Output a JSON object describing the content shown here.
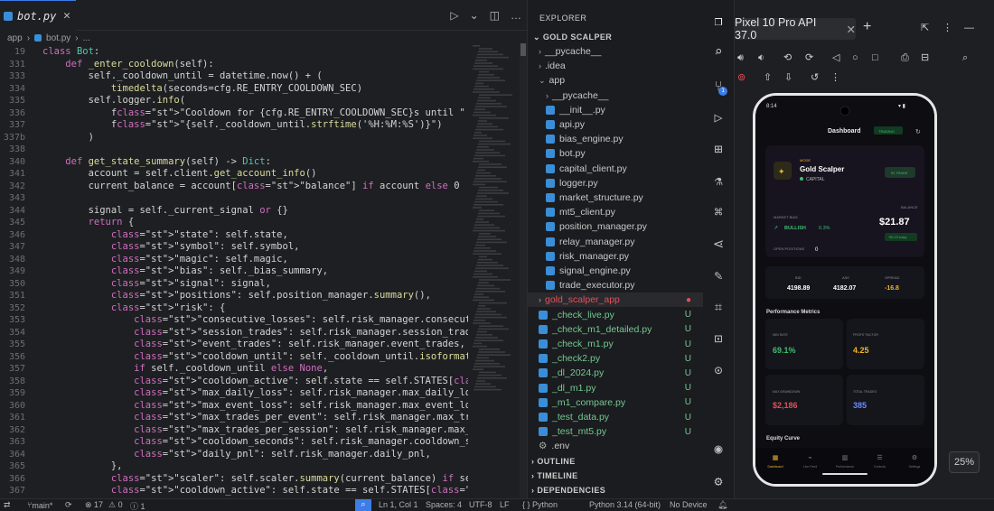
{
  "editor": {
    "tab_label": "bot.py",
    "tab_close": "✕",
    "breadcrumb": [
      "app",
      "bot.py",
      "..."
    ],
    "lines": [
      {
        "n": "19",
        "t": "class Bot:"
      },
      {
        "n": "331",
        "t": "    def _enter_cooldown(self):"
      },
      {
        "n": "333",
        "t": "        self._cooldown_until = datetime.now() + ("
      },
      {
        "n": "334",
        "t": "            timedelta(seconds=cfg.RE_ENTRY_COOLDOWN_SEC)"
      },
      {
        "n": "335",
        "t": "        self.logger.info("
      },
      {
        "n": "336",
        "t": "            f\"Cooldown for {cfg.RE_ENTRY_COOLDOWN_SEC}s until \""
      },
      {
        "n": "337",
        "t": "            f\"{self._cooldown_until.strftime('%H:%M:%S')}\")"
      },
      {
        "n": "337b",
        "t": "        )"
      },
      {
        "n": "338",
        "t": ""
      },
      {
        "n": "340",
        "t": "    def get_state_summary(self) -> Dict:"
      },
      {
        "n": "341",
        "t": "        account = self.client.get_account_info()"
      },
      {
        "n": "342",
        "t": "        current_balance = account[\"balance\"] if account else 0"
      },
      {
        "n": "343",
        "t": ""
      },
      {
        "n": "344",
        "t": "        signal = self._current_signal or {}"
      },
      {
        "n": "345",
        "t": "        return {"
      },
      {
        "n": "346",
        "t": "            \"state\": self.state,"
      },
      {
        "n": "347",
        "t": "            \"symbol\": self.symbol,"
      },
      {
        "n": "348",
        "t": "            \"magic\": self.magic,"
      },
      {
        "n": "349",
        "t": "            \"bias\": self._bias_summary,"
      },
      {
        "n": "350",
        "t": "            \"signal\": signal,"
      },
      {
        "n": "351",
        "t": "            \"positions\": self.position_manager.summary(),"
      },
      {
        "n": "352",
        "t": "            \"risk\": {"
      },
      {
        "n": "353",
        "t": "                \"consecutive_losses\": self.risk_manager.consecutive_losses,"
      },
      {
        "n": "354",
        "t": "                \"session_trades\": self.risk_manager.session_trades,"
      },
      {
        "n": "355",
        "t": "                \"event_trades\": self.risk_manager.event_trades,"
      },
      {
        "n": "356",
        "t": "                \"cooldown_until\": self._cooldown_until.isoformat()"
      },
      {
        "n": "357",
        "t": "                if self._cooldown_until else None,"
      },
      {
        "n": "358",
        "t": "                \"cooldown_active\": self.state == self.STATES[\"COOLDOWN\"],"
      },
      {
        "n": "359",
        "t": "                \"max_daily_loss\": self.risk_manager.max_daily_loss,"
      },
      {
        "n": "360",
        "t": "                \"max_event_loss\": self.risk_manager.max_event_loss,"
      },
      {
        "n": "361",
        "t": "                \"max_trades_per_event\": self.risk_manager.max_trades_per_event,"
      },
      {
        "n": "362",
        "t": "                \"max_trades_per_session\": self.risk_manager.max_trades_per_session,"
      },
      {
        "n": "363",
        "t": "                \"cooldown_seconds\": self.risk_manager.cooldown_seconds,"
      },
      {
        "n": "364",
        "t": "                \"daily_pnl\": self.risk_manager.daily_pnl,"
      },
      {
        "n": "365",
        "t": "            },"
      },
      {
        "n": "366",
        "t": "            \"scaler\": self.scaler.summary(current_balance) if self.scaler.starting_"
      },
      {
        "n": "367",
        "t": "            \"cooldown_active\": self.state == self.STATES[\"COOLDOWN\"]"
      }
    ]
  },
  "explorer": {
    "header": "EXPLORER",
    "project": "GOLD SCALPER",
    "items": [
      {
        "label": "__pycache__",
        "kind": "folder",
        "indent": 1,
        "chev": "›"
      },
      {
        "label": ".idea",
        "kind": "folder",
        "indent": 1,
        "chev": "›"
      },
      {
        "label": "app",
        "kind": "folder",
        "indent": 1,
        "chev": "⌄"
      },
      {
        "label": "__pycache__",
        "kind": "folder",
        "indent": 2,
        "chev": "›"
      },
      {
        "label": "__init__.py",
        "kind": "py",
        "indent": 2
      },
      {
        "label": "api.py",
        "kind": "py",
        "indent": 2
      },
      {
        "label": "bias_engine.py",
        "kind": "py",
        "indent": 2
      },
      {
        "label": "bot.py",
        "kind": "py",
        "indent": 2
      },
      {
        "label": "capital_client.py",
        "kind": "py",
        "indent": 2
      },
      {
        "label": "logger.py",
        "kind": "py",
        "indent": 2
      },
      {
        "label": "market_structure.py",
        "kind": "py",
        "indent": 2
      },
      {
        "label": "mt5_client.py",
        "kind": "py",
        "indent": 2
      },
      {
        "label": "position_manager.py",
        "kind": "py",
        "indent": 2
      },
      {
        "label": "relay_manager.py",
        "kind": "py",
        "indent": 2
      },
      {
        "label": "risk_manager.py",
        "kind": "py",
        "indent": 2
      },
      {
        "label": "signal_engine.py",
        "kind": "py",
        "indent": 2
      },
      {
        "label": "trade_executor.py",
        "kind": "py",
        "indent": 2
      },
      {
        "label": "gold_scalper_app",
        "kind": "folder-red",
        "indent": 1,
        "chev": "›",
        "status": "●"
      },
      {
        "label": "_check_live.py",
        "kind": "new",
        "indent": 1,
        "status": "U"
      },
      {
        "label": "_check_m1_detailed.py",
        "kind": "new",
        "indent": 1,
        "status": "U"
      },
      {
        "label": "_check_m1.py",
        "kind": "new",
        "indent": 1,
        "status": "U"
      },
      {
        "label": "_check2.py",
        "kind": "new",
        "indent": 1,
        "status": "U"
      },
      {
        "label": "_dl_2024.py",
        "kind": "new",
        "indent": 1,
        "status": "U"
      },
      {
        "label": "_dl_m1.py",
        "kind": "new",
        "indent": 1,
        "status": "U"
      },
      {
        "label": "_m1_compare.py",
        "kind": "new",
        "indent": 1,
        "status": "U"
      },
      {
        "label": "_test_data.py",
        "kind": "new",
        "indent": 1,
        "status": "U"
      },
      {
        "label": "_test_mt5.py",
        "kind": "new",
        "indent": 1,
        "status": "U"
      },
      {
        "label": ".env",
        "kind": "gear",
        "indent": 1
      }
    ],
    "sections": [
      "OUTLINE",
      "TIMELINE",
      "DEPENDENCIES"
    ]
  },
  "emulator": {
    "device_tab": "Pixel 10 Pro API 37.0",
    "zoom": "25%",
    "app": {
      "time": "8:14",
      "title": "Dashboard",
      "trading_badge": "TRADING",
      "mode": "MODE",
      "name": "Gold Scalper",
      "account": "CAPITAL",
      "in_trade": "IN TRADE",
      "balance_label": "BALANCE",
      "balance": "$21.87",
      "balance_change": "+$1.23 today",
      "bias_label": "MARKET BIAS",
      "bias": "BULLISH",
      "bias_pct": "0.3%",
      "open_positions_label": "OPEN POSITIONS",
      "open_positions": "0",
      "bid_label": "BID",
      "bid": "4198.89",
      "ask_label": "ASK",
      "ask": "4182.07",
      "spread_label": "SPREAD",
      "spread": "-16.8",
      "perf_title": "Performance Metrics",
      "win_rate_label": "WIN RATE",
      "win_rate": "69.1%",
      "pf_label": "PROFIT FACTOR",
      "pf": "4.25",
      "drawdown_label": "MAX DRAWDOWN",
      "drawdown": "$2,186",
      "trades_label": "TOTAL TRADES",
      "trades": "385",
      "equity_title": "Equity Curve",
      "nav": [
        "Dashboard",
        "Live Feed",
        "Performance",
        "Controls",
        "Settings"
      ]
    }
  },
  "status": {
    "branch": "main*",
    "sync": "⟳",
    "errors": "⊗ 17",
    "warnings": "⚠ 0",
    "info": "ⓘ 1",
    "position": "Ln 1, Col 1",
    "spaces": "Spaces: 4",
    "encoding": "UTF-8",
    "eol": "LF",
    "language": "{ } Python",
    "interpreter": "Python 3.14 (64-bit)",
    "device": "No Device"
  },
  "colors": {
    "accent": "#3d7de8",
    "gold": "#f0b429",
    "success": "#3fbf6f",
    "danger": "#e0525a",
    "info": "#6a8dff",
    "untracked": "#73c991"
  }
}
